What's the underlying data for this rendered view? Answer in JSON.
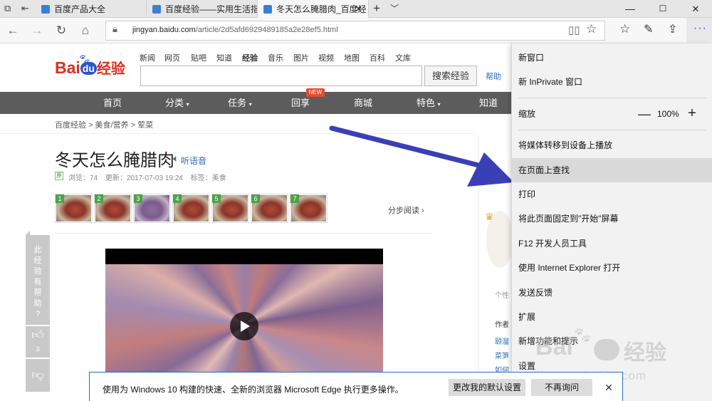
{
  "tabs": [
    {
      "label": "百度产品大全"
    },
    {
      "label": "百度经验——实用生活指南"
    },
    {
      "label": "冬天怎么腌腊肉_百度经",
      "active": true
    }
  ],
  "window": {
    "minimize": "—",
    "maximize": "☐",
    "close": "✕"
  },
  "address": {
    "domain": "jingyan.baidu.com",
    "path": "/article/2d5afd6929489185a2e28ef5.html"
  },
  "site": {
    "top_links": [
      "新闻",
      "网页",
      "贴吧",
      "知道",
      "经验",
      "音乐",
      "图片",
      "视频",
      "地图",
      "百科",
      "文库"
    ],
    "logo_text": "Bai",
    "logo_du": "du",
    "logo_jingyan": "经验",
    "search_button": "搜索经验",
    "help": "帮助",
    "menu": [
      "首页",
      "分类",
      "任务",
      "回享",
      "商城",
      "特色",
      "知道"
    ],
    "new_badge": "NEW",
    "breadcrumb": [
      "百度经验",
      "美食/营养",
      "荤菜"
    ],
    "title": "冬天怎么腌腊肉",
    "tts": "听语音",
    "orig": "原",
    "meta": {
      "views": "浏览：74",
      "updated": "更新：2017-07-03 19:24",
      "tags": "标签：美食"
    },
    "steps": [
      "1",
      "2",
      "3",
      "4",
      "5",
      "6",
      "7"
    ],
    "step_link": "分步阅读",
    "helpful": [
      "此",
      "经",
      "验",
      "有",
      "帮",
      "助",
      "?"
    ],
    "like_count": "3",
    "side_texts": [
      "个性",
      "作者",
      "颐溜",
      "菜笋",
      "如何"
    ]
  },
  "menu": {
    "items": [
      {
        "label": "新窗口"
      },
      {
        "label": "新 InPrivate 窗口"
      },
      {
        "label": "缩放",
        "zoom": "100%"
      },
      {
        "label": "将媒体转移到设备上播放"
      },
      {
        "label": "在页面上查找",
        "highlight": true
      },
      {
        "label": "打印"
      },
      {
        "label": "将此页面固定到\"开始\"屏幕"
      },
      {
        "label": "F12 开发人员工具"
      },
      {
        "label": "使用 Internet Explorer 打开"
      },
      {
        "label": "发送反馈"
      },
      {
        "label": "扩展"
      },
      {
        "label": "新增功能和提示"
      },
      {
        "label": "设置"
      }
    ],
    "zoom_minus": "—",
    "zoom_plus": "+"
  },
  "notification": {
    "text": "使用为 Windows 10 构建的快速、全新的浏览器 Microsoft Edge 执行更多操作。",
    "btn_default": "更改我的默认设置",
    "btn_noask": "不再询问",
    "close": "✕"
  },
  "watermark": {
    "line1": "Bai",
    "line2": "经验",
    "url": "jingyan.baidu.com"
  },
  "colors": {
    "accent": "#2a6fb5",
    "arrow": "#3b3fb6",
    "menubar": "#5c5c5c",
    "logo_red": "#de2e21",
    "logo_blue": "#2b56c6"
  }
}
